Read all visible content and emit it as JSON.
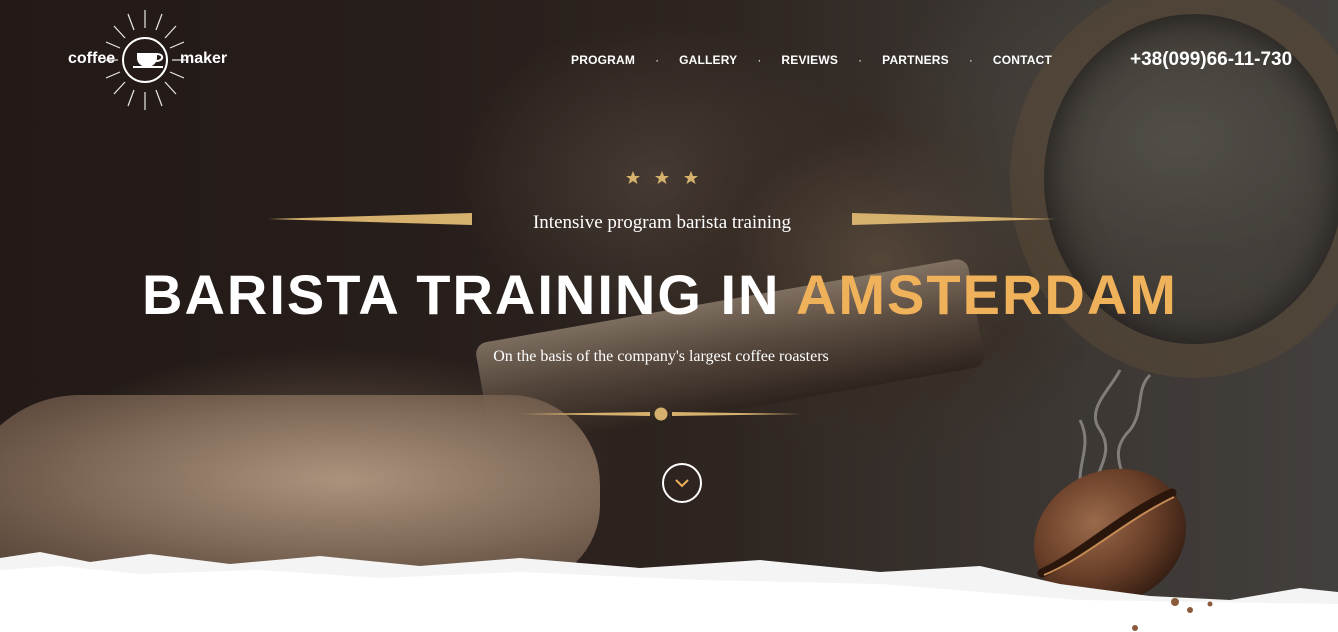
{
  "logo": {
    "left_text": "coffee",
    "right_text": "maker",
    "icon": "coffee-cup-icon"
  },
  "nav": {
    "items": [
      {
        "label": "PROGRAM"
      },
      {
        "label": "GALLERY"
      },
      {
        "label": "REVIEWS"
      },
      {
        "label": "PARTNERS"
      },
      {
        "label": "CONTACT"
      }
    ],
    "separator": "·"
  },
  "phone": "+38(099)66-11-730",
  "hero": {
    "stars_icon": "star-icon",
    "subtitle": "Intensive program barista training",
    "headline_main": "BARISTA TRAINING IN ",
    "headline_accent": "AMSTERDAM",
    "tagline": "On the basis of the company's largest coffee roasters",
    "scroll_icon": "chevron-down-icon"
  },
  "colors": {
    "accent": "#f0b15b",
    "gold_rule": "#d6b16e",
    "text": "#ffffff"
  }
}
